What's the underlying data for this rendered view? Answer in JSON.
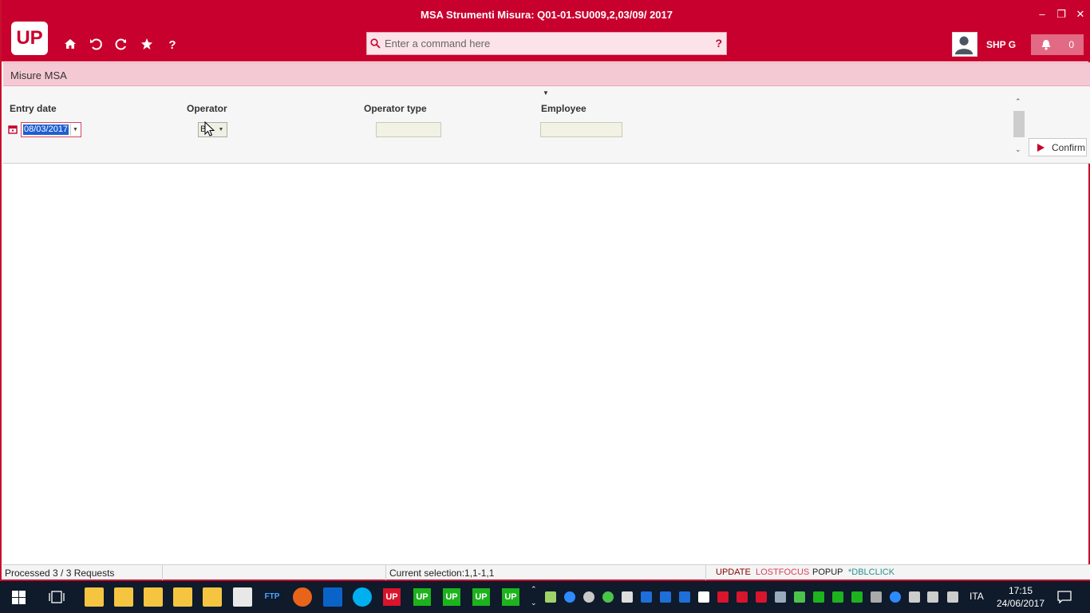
{
  "window": {
    "title": "MSA Strumenti Misura: Q01-01.SU009,2,03/09/ 2017",
    "min": "–",
    "max": "❐",
    "close": "✕"
  },
  "header": {
    "logo": "UP",
    "search_placeholder": "Enter a command here",
    "help": "?",
    "user": "SHP G",
    "notifications": "0"
  },
  "subbar": {
    "title": "Misure MSA"
  },
  "form": {
    "entry_date_label": "Entry date",
    "entry_date_value": "08/03/2017",
    "operator_label": "Operator",
    "operator_value": "B",
    "operator_type_label": "Operator type",
    "employee_label": "Employee",
    "confirm_label": "Confirm"
  },
  "status": {
    "processed": "Processed 3 / 3 Requests",
    "selection": "Current selection:1,1-1,1",
    "update": "UPDATE",
    "lostfocus": "LOSTFOCUS",
    "popup": "POPUP",
    "dblclick": "*DBLCLICK"
  },
  "taskbar": {
    "ftp": "FTP",
    "up": "UP",
    "lang": "ITA",
    "time": "17:15",
    "date": "24/06/2017"
  },
  "colors": {
    "brand": "#c8002d",
    "up_green": "#1db31d",
    "up_red": "#d9142d"
  }
}
